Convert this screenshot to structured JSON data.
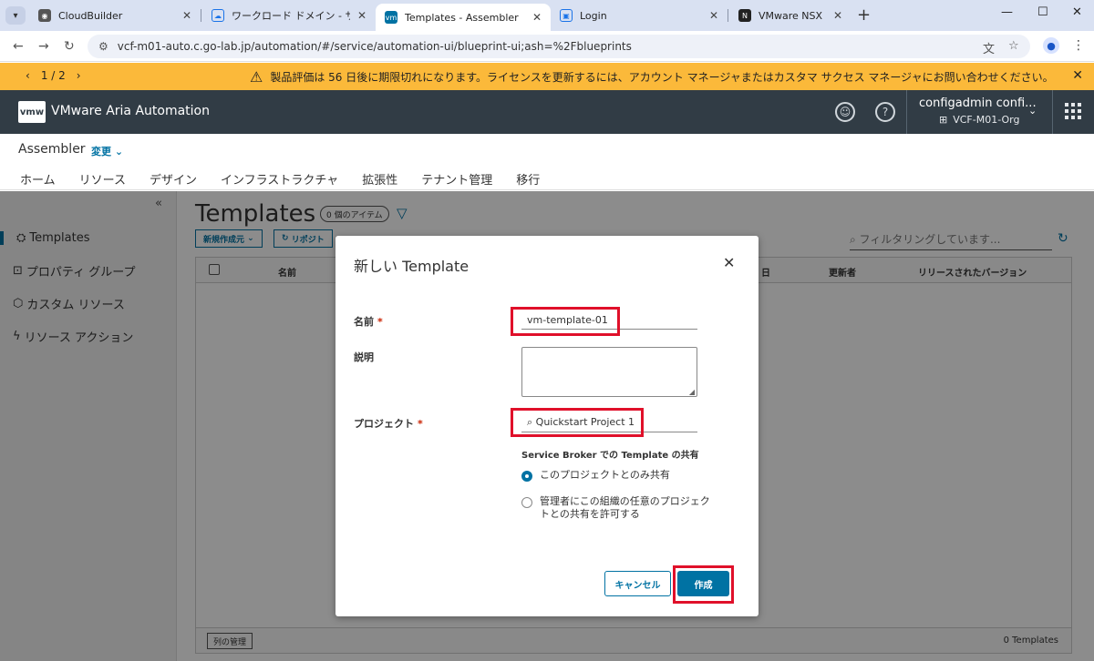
{
  "browser": {
    "tabs": [
      {
        "label": "CloudBuilder",
        "active": false
      },
      {
        "label": "ワークロード ドメイン - サマリ",
        "active": false
      },
      {
        "label": "Templates - Assembler",
        "active": true
      },
      {
        "label": "Login",
        "active": false
      },
      {
        "label": "VMware NSX | ログイン",
        "active": false
      }
    ],
    "url": "vcf-m01-auto.c.go-lab.jp/automation/#/service/automation-ui/blueprint-ui;ash=%2Fblueprints"
  },
  "banner": {
    "pager": "1 / 2",
    "message": "製品評価は 56 日後に期限切れになります。ライセンスを更新するには、アカウント マネージャまたはカスタマ サクセス マネージャにお問い合わせください。"
  },
  "header": {
    "logo": "vmw",
    "app_name": "VMware Aria Automation",
    "user_name": "configadmin confi...",
    "org": "VCF-M01-Org"
  },
  "service": {
    "name": "Assembler",
    "change": "変更",
    "nav_tabs": [
      {
        "label": "ホーム",
        "active": false
      },
      {
        "label": "リソース",
        "active": false
      },
      {
        "label": "デザイン",
        "active": true
      },
      {
        "label": "インフラストラクチャ",
        "active": false
      },
      {
        "label": "拡張性",
        "active": false
      },
      {
        "label": "テナント管理",
        "active": false
      },
      {
        "label": "移行",
        "active": false
      }
    ]
  },
  "sidebar": {
    "items": [
      {
        "label": "Templates",
        "active": true
      },
      {
        "label": "プロパティ グループ",
        "active": false
      },
      {
        "label": "カスタム リソース",
        "active": false
      },
      {
        "label": "リソース アクション",
        "active": false
      }
    ]
  },
  "main": {
    "title": "Templates",
    "count_badge": "0 個のアイテム",
    "new_button": "新規作成元",
    "repo_button": "リポジト",
    "search_placeholder": "フィルタリングしています...",
    "columns": [
      "名前",
      "日",
      "更新者",
      "リリースされたバージョン"
    ],
    "column_manager": "列の管理",
    "total": "0 Templates"
  },
  "modal": {
    "title": "新しい Template",
    "name_label": "名前",
    "name_value": "vm-template-01",
    "description_label": "説明",
    "project_label": "プロジェクト",
    "project_value": "Quickstart Project 1",
    "share_title": "Service Broker での Template の共有",
    "share_options": [
      {
        "label": "このプロジェクトとのみ共有",
        "checked": true
      },
      {
        "label": "管理者にこの組織の任意のプロジェクトとの共有を許可する",
        "checked": false
      }
    ],
    "cancel": "キャンセル",
    "create": "作成"
  }
}
